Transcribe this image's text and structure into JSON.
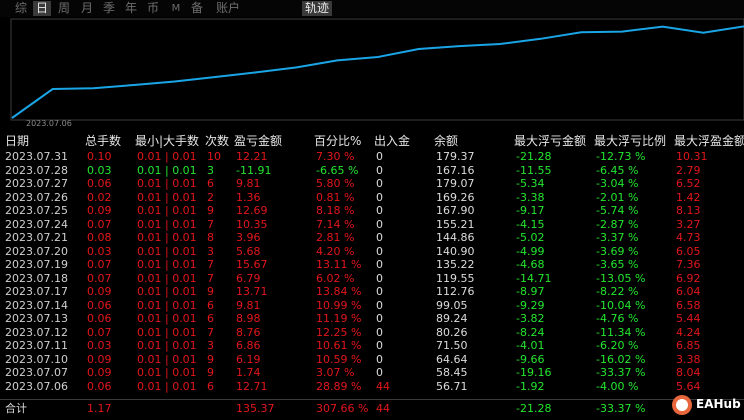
{
  "tabs": [
    "综",
    "日",
    "周",
    "月",
    "季",
    "年",
    "币",
    "M",
    "备",
    "账户"
  ],
  "selected_tab": "日",
  "track_tab": "轨迹",
  "chart": {
    "start_date": "2023.07.06",
    "line_color": "#1aa5e6",
    "values": [
      0,
      56.71,
      58.45,
      64.64,
      71.5,
      80.26,
      89.24,
      99.05,
      112.76,
      119.55,
      135.22,
      140.9,
      144.86,
      155.21,
      167.9,
      169.26,
      179.07,
      167.16,
      179.37
    ]
  },
  "columns": [
    "日期",
    "总手数",
    "最小|大手数",
    "次数",
    "盈亏金额",
    "百分比%",
    "出入金",
    "余额",
    "最大浮亏金额",
    "最大浮亏比例",
    "最大浮盈金额"
  ],
  "rows": [
    {
      "date": "2023.07.31",
      "lots": "0.10",
      "minmax": "0.01 | 0.01",
      "count": "10",
      "pl": "12.21",
      "pct": "7.30 %",
      "io": "0",
      "bal": "179.37",
      "mfl": "-21.28",
      "mflp": "-12.73 %",
      "mfp": "10.31",
      "tone": "red"
    },
    {
      "date": "2023.07.28",
      "lots": "0.03",
      "minmax": "0.01 | 0.01",
      "count": "3",
      "pl": "-11.91",
      "pct": "-6.65 %",
      "io": "0",
      "bal": "167.16",
      "mfl": "-11.55",
      "mflp": "-6.45 %",
      "mfp": "2.79",
      "tone": "green"
    },
    {
      "date": "2023.07.27",
      "lots": "0.06",
      "minmax": "0.01 | 0.01",
      "count": "6",
      "pl": "9.81",
      "pct": "5.80 %",
      "io": "0",
      "bal": "179.07",
      "mfl": "-5.34",
      "mflp": "-3.04 %",
      "mfp": "6.52",
      "tone": "red"
    },
    {
      "date": "2023.07.26",
      "lots": "0.02",
      "minmax": "0.01 | 0.01",
      "count": "2",
      "pl": "1.36",
      "pct": "0.81 %",
      "io": "0",
      "bal": "169.26",
      "mfl": "-3.38",
      "mflp": "-2.01 %",
      "mfp": "1.42",
      "tone": "red"
    },
    {
      "date": "2023.07.25",
      "lots": "0.09",
      "minmax": "0.01 | 0.01",
      "count": "9",
      "pl": "12.69",
      "pct": "8.18 %",
      "io": "0",
      "bal": "167.90",
      "mfl": "-9.17",
      "mflp": "-5.74 %",
      "mfp": "8.13",
      "tone": "red"
    },
    {
      "date": "2023.07.24",
      "lots": "0.07",
      "minmax": "0.01 | 0.01",
      "count": "7",
      "pl": "10.35",
      "pct": "7.14 %",
      "io": "0",
      "bal": "155.21",
      "mfl": "-4.15",
      "mflp": "-2.87 %",
      "mfp": "3.27",
      "tone": "red"
    },
    {
      "date": "2023.07.21",
      "lots": "0.08",
      "minmax": "0.01 | 0.01",
      "count": "8",
      "pl": "3.96",
      "pct": "2.81 %",
      "io": "0",
      "bal": "144.86",
      "mfl": "-5.02",
      "mflp": "-3.37 %",
      "mfp": "4.73",
      "tone": "red"
    },
    {
      "date": "2023.07.20",
      "lots": "0.03",
      "minmax": "0.01 | 0.01",
      "count": "3",
      "pl": "5.68",
      "pct": "4.20 %",
      "io": "0",
      "bal": "140.90",
      "mfl": "-4.99",
      "mflp": "-3.69 %",
      "mfp": "6.05",
      "tone": "red"
    },
    {
      "date": "2023.07.19",
      "lots": "0.07",
      "minmax": "0.01 | 0.01",
      "count": "7",
      "pl": "15.67",
      "pct": "13.11 %",
      "io": "0",
      "bal": "135.22",
      "mfl": "-4.68",
      "mflp": "-3.65 %",
      "mfp": "7.36",
      "tone": "red"
    },
    {
      "date": "2023.07.18",
      "lots": "0.07",
      "minmax": "0.01 | 0.01",
      "count": "7",
      "pl": "6.79",
      "pct": "6.02 %",
      "io": "0",
      "bal": "119.55",
      "mfl": "-14.71",
      "mflp": "-13.05 %",
      "mfp": "6.92",
      "tone": "red"
    },
    {
      "date": "2023.07.17",
      "lots": "0.09",
      "minmax": "0.01 | 0.01",
      "count": "9",
      "pl": "13.71",
      "pct": "13.84 %",
      "io": "0",
      "bal": "112.76",
      "mfl": "-8.97",
      "mflp": "-8.22 %",
      "mfp": "6.04",
      "tone": "red"
    },
    {
      "date": "2023.07.14",
      "lots": "0.06",
      "minmax": "0.01 | 0.01",
      "count": "6",
      "pl": "9.81",
      "pct": "10.99 %",
      "io": "0",
      "bal": "99.05",
      "mfl": "-9.29",
      "mflp": "-10.04 %",
      "mfp": "6.58",
      "tone": "red"
    },
    {
      "date": "2023.07.13",
      "lots": "0.06",
      "minmax": "0.01 | 0.01",
      "count": "6",
      "pl": "8.98",
      "pct": "11.19 %",
      "io": "0",
      "bal": "89.24",
      "mfl": "-3.82",
      "mflp": "-4.76 %",
      "mfp": "5.44",
      "tone": "red"
    },
    {
      "date": "2023.07.12",
      "lots": "0.07",
      "minmax": "0.01 | 0.01",
      "count": "7",
      "pl": "8.76",
      "pct": "12.25 %",
      "io": "0",
      "bal": "80.26",
      "mfl": "-8.24",
      "mflp": "-11.34 %",
      "mfp": "4.24",
      "tone": "red"
    },
    {
      "date": "2023.07.11",
      "lots": "0.03",
      "minmax": "0.01 | 0.01",
      "count": "3",
      "pl": "6.86",
      "pct": "10.61 %",
      "io": "0",
      "bal": "71.50",
      "mfl": "-4.01",
      "mflp": "-6.20 %",
      "mfp": "6.85",
      "tone": "red"
    },
    {
      "date": "2023.07.10",
      "lots": "0.09",
      "minmax": "0.01 | 0.01",
      "count": "9",
      "pl": "6.19",
      "pct": "10.59 %",
      "io": "0",
      "bal": "64.64",
      "mfl": "-9.66",
      "mflp": "-16.02 %",
      "mfp": "3.38",
      "tone": "red"
    },
    {
      "date": "2023.07.07",
      "lots": "0.09",
      "minmax": "0.01 | 0.01",
      "count": "9",
      "pl": "1.74",
      "pct": "3.07 %",
      "io": "0",
      "bal": "58.45",
      "mfl": "-19.16",
      "mflp": "-33.37 %",
      "mfp": "8.04",
      "tone": "red"
    },
    {
      "date": "2023.07.06",
      "lots": "0.06",
      "minmax": "0.01 | 0.01",
      "count": "6",
      "pl": "12.71",
      "pct": "28.89 %",
      "io": "44",
      "bal": "56.71",
      "mfl": "-1.92",
      "mflp": "-4.00 %",
      "mfp": "5.64",
      "tone": "red"
    }
  ],
  "total": {
    "label": "合计",
    "lots": "1.17",
    "pl": "135.37",
    "pct": "307.66 %",
    "io": "44",
    "mfl": "-21.28",
    "mflp": "-33.37 %"
  },
  "watermark": "EAHub"
}
